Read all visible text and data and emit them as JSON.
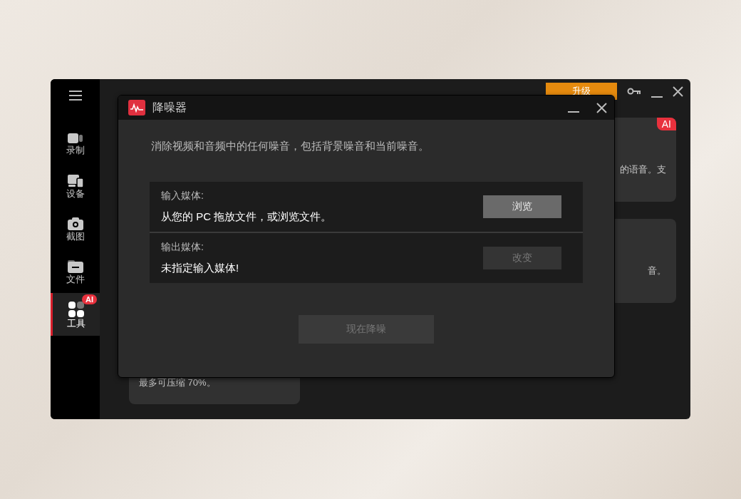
{
  "app": {
    "upgrade_button": "升级",
    "sidebar": [
      {
        "kind": "record",
        "label": "录制",
        "selected": false
      },
      {
        "kind": "device",
        "label": "设备",
        "selected": false
      },
      {
        "kind": "screenshot",
        "label": "截图",
        "selected": false
      },
      {
        "kind": "files",
        "label": "文件",
        "selected": false
      },
      {
        "kind": "tools",
        "label": "工具",
        "selected": true,
        "badge": "AI"
      }
    ],
    "cards": [
      {
        "badge": "AI",
        "text": "的语音。支"
      },
      {
        "text": "音。"
      },
      {
        "text": "最多可压缩 70%。"
      }
    ]
  },
  "dialog": {
    "title": "降噪器",
    "description": "消除视频和音频中的任何噪音，包括背景噪音和当前噪音。",
    "rows": [
      {
        "label": "输入媒体:",
        "value": "从您的 PC 拖放文件，或浏览文件。",
        "button": "浏览",
        "disabled": false
      },
      {
        "label": "输出媒体:",
        "value": "未指定输入媒体!",
        "button": "改变",
        "disabled": true
      }
    ],
    "action_button": {
      "label": "现在降噪",
      "disabled": true
    }
  }
}
